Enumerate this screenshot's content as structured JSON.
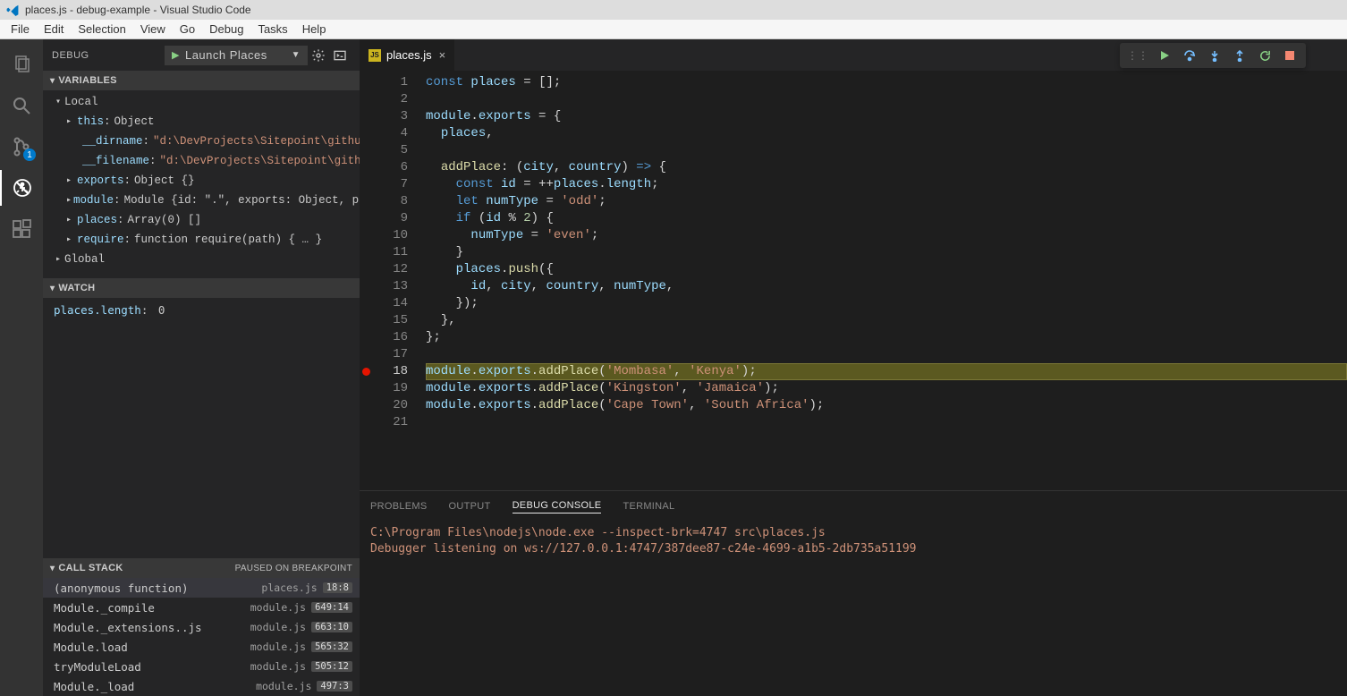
{
  "window": {
    "title": "places.js - debug-example - Visual Studio Code"
  },
  "menu": [
    "File",
    "Edit",
    "Selection",
    "View",
    "Go",
    "Debug",
    "Tasks",
    "Help"
  ],
  "activityBar": {
    "items": [
      {
        "name": "explorer-icon"
      },
      {
        "name": "search-icon"
      },
      {
        "name": "source-control-icon",
        "badge": "1"
      },
      {
        "name": "debug-icon",
        "active": true
      },
      {
        "name": "extensions-icon"
      }
    ]
  },
  "sidebar": {
    "title": "DEBUG",
    "launchConfig": "Launch Places",
    "sections": {
      "variables": {
        "label": "VARIABLES",
        "scopes": [
          {
            "name": "Local",
            "expanded": true,
            "vars": [
              {
                "key": "this",
                "value": "Object",
                "expandable": true
              },
              {
                "key": "__dirname",
                "value": "\"d:\\DevProjects\\Sitepoint\\github\\…",
                "string": true,
                "indent": true
              },
              {
                "key": "__filename",
                "value": "\"d:\\DevProjects\\Sitepoint\\github…",
                "string": true,
                "indent": true
              },
              {
                "key": "exports",
                "value": "Object {}",
                "expandable": true
              },
              {
                "key": "module",
                "value": "Module {id: \".\", exports: Object, pa…",
                "expandable": true
              },
              {
                "key": "places",
                "value": "Array(0) []",
                "expandable": true
              },
              {
                "key": "require",
                "value": "function require(path) { … }",
                "expandable": true
              }
            ]
          },
          {
            "name": "Global",
            "expanded": false
          }
        ]
      },
      "watch": {
        "label": "WATCH",
        "items": [
          {
            "expr": "places.length",
            "value": "0"
          }
        ]
      },
      "callstack": {
        "label": "CALL STACK",
        "status": "PAUSED ON BREAKPOINT",
        "frames": [
          {
            "fn": "(anonymous function)",
            "file": "places.js",
            "loc": "18:8",
            "selected": true
          },
          {
            "fn": "Module._compile",
            "file": "module.js",
            "loc": "649:14"
          },
          {
            "fn": "Module._extensions..js",
            "file": "module.js",
            "loc": "663:10"
          },
          {
            "fn": "Module.load",
            "file": "module.js",
            "loc": "565:32"
          },
          {
            "fn": "tryModuleLoad",
            "file": "module.js",
            "loc": "505:12"
          },
          {
            "fn": "Module._load",
            "file": "module.js",
            "loc": "497:3"
          }
        ]
      }
    }
  },
  "editor": {
    "tabName": "places.js",
    "activeLine": 18,
    "breakpointLines": [
      18
    ],
    "lines": 21
  },
  "panel": {
    "tabs": [
      "PROBLEMS",
      "OUTPUT",
      "DEBUG CONSOLE",
      "TERMINAL"
    ],
    "activeTab": "DEBUG CONSOLE",
    "console": [
      "C:\\Program Files\\nodejs\\node.exe --inspect-brk=4747 src\\places.js",
      "Debugger listening on ws://127.0.0.1:4747/387dee87-c24e-4699-a1b5-2db735a51199"
    ]
  },
  "debugToolbar": {
    "buttons": [
      "continue",
      "step-over",
      "step-into",
      "step-out",
      "restart",
      "stop"
    ]
  }
}
